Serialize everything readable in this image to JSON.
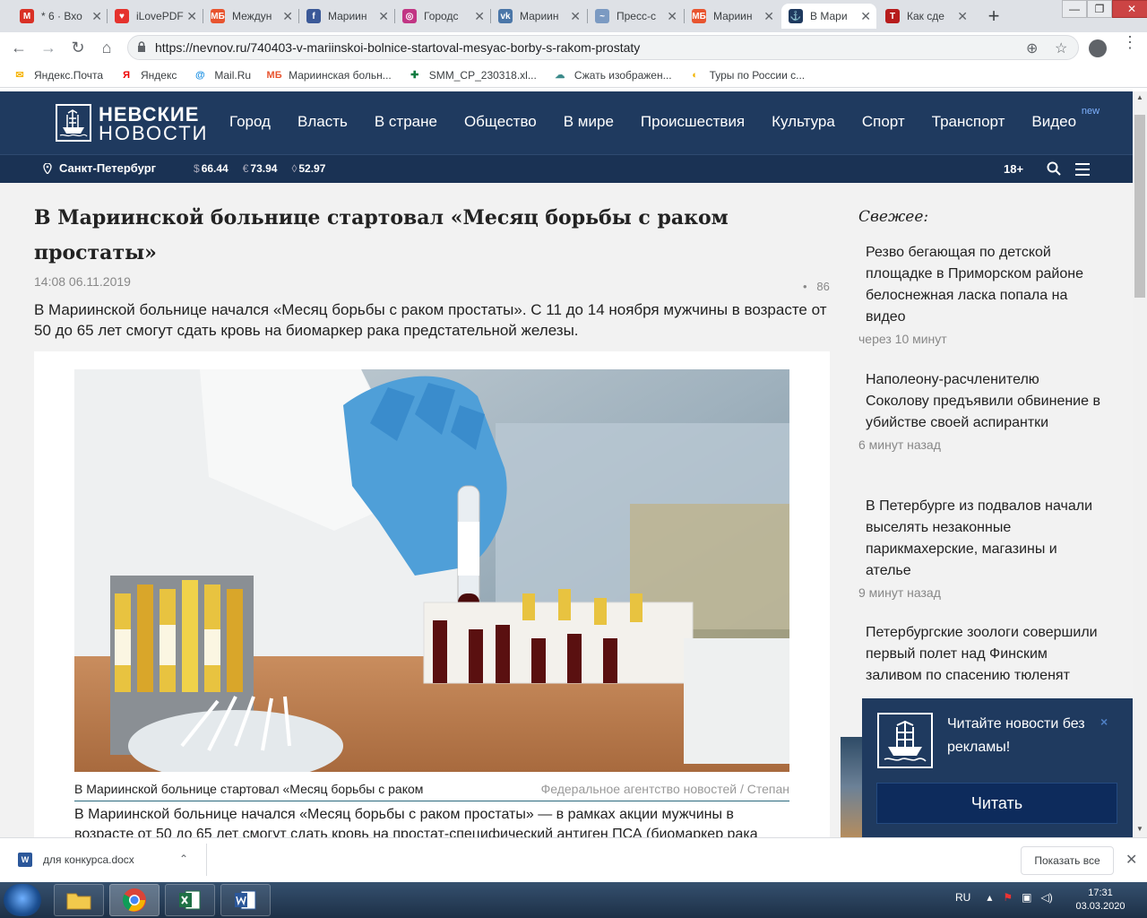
{
  "browser": {
    "tabs": [
      {
        "title": "* 6 · Вхо",
        "fav": "gmail-icon",
        "color": "#d93025",
        "glyph": "M"
      },
      {
        "title": "iLovePDF",
        "fav": "heart-icon",
        "color": "#e5322d",
        "glyph": "♥"
      },
      {
        "title": "Междун",
        "fav": "mb-icon",
        "color": "#e8542f",
        "glyph": "МБ"
      },
      {
        "title": "Мариин",
        "fav": "facebook-icon",
        "color": "#3b5998",
        "glyph": "f"
      },
      {
        "title": "Городс",
        "fav": "instagram-icon",
        "color": "#c13584",
        "glyph": "◎"
      },
      {
        "title": "Мариин",
        "fav": "vk-icon",
        "color": "#4a76a8",
        "glyph": "vk"
      },
      {
        "title": "Пресс-с",
        "fav": "press-icon",
        "color": "#7b9ac2",
        "glyph": "~"
      },
      {
        "title": "Мариин",
        "fav": "mb-icon",
        "color": "#e8542f",
        "glyph": "МБ"
      },
      {
        "title": "В Мари",
        "fav": "nevnov-icon",
        "color": "#1f3a5f",
        "glyph": "⚓"
      },
      {
        "title": "Как сде",
        "fav": "doc-icon",
        "color": "#b71c1c",
        "glyph": "T"
      }
    ],
    "url": "https://nevnov.ru/740403-v-mariinskoi-bolnice-startoval-mesyac-borby-s-rakom-prostaty",
    "bookmarks": [
      {
        "label": "Яндекс.Почта",
        "color": "#f6b400",
        "glyph": "✉"
      },
      {
        "label": "Яндекс",
        "color": "#e00",
        "glyph": "Я"
      },
      {
        "label": "Mail.Ru",
        "color": "#168de2",
        "glyph": "@"
      },
      {
        "label": "Мариинская больн...",
        "color": "#e8542f",
        "glyph": "МБ"
      },
      {
        "label": "SMM_CP_230318.xl...",
        "color": "#107c41",
        "glyph": "✚"
      },
      {
        "label": "Сжать изображен...",
        "color": "#3b8a8a",
        "glyph": "☁"
      },
      {
        "label": "Туры по России с...",
        "color": "#f2b400",
        "glyph": "◐"
      }
    ]
  },
  "site": {
    "logo_line1": "НЕВСКИЕ",
    "logo_line2": "НОВОСТИ",
    "nav": [
      "Город",
      "Власть",
      "В стране",
      "Общество",
      "В мире",
      "Происшествия",
      "Культура",
      "Спорт",
      "Транспорт",
      "Видео"
    ],
    "nav_badge": "new",
    "city": "Санкт-Петербург",
    "rates": [
      {
        "sym": "$",
        "value": "66.44"
      },
      {
        "sym": "€",
        "value": "73.94"
      },
      {
        "sym": "◊",
        "value": "52.97"
      }
    ],
    "age": "18+"
  },
  "article": {
    "title": "В Мариинской больнице стартовал «Месяц борьбы с раком простаты»",
    "date": "14:08 06.11.2019",
    "views_prefix": "•",
    "views": "86",
    "lead": "В Мариинской больнице начался «Месяц борьбы с раком простаты». С 11 до 14 ноября мужчины в возрасте от 50 до 65 лет смогут сдать кровь на биомаркер рака предстательной железы.",
    "caption": "В Мариинской больнице стартовал «Месяц борьбы с раком",
    "credit": "Федеральное агентство новостей / Степан",
    "body": "В Мариинской больнице начался «Месяц борьбы с раком простаты» — в рамках акции мужчины в возрасте от 50 до 65 лет смогут сдать кровь на простат-специфический антиген ПСА (биомаркер рака"
  },
  "sidebar": {
    "heading": "Свежее:",
    "items": [
      {
        "text": "Резво бегающая по детской площадке в Приморском районе белоснежная ласка попала на видео",
        "meta": "через 10 минут"
      },
      {
        "text": "Наполеону-расчленителю Соколову предъявили обвинение в убийстве своей аспирантки",
        "meta": "6 минут назад"
      },
      {
        "text": "В Петербурге из подвалов начали выселять незаконные парикмахерские, магазины и ателье",
        "meta": "9 минут назад"
      },
      {
        "text": "Петербургские зоологи совершили первый полет над Финским заливом по спасению тюленят",
        "meta": ""
      }
    ]
  },
  "popup": {
    "text": "Читайте новости без рекламы!",
    "close": "×",
    "button": "Читать"
  },
  "downloads": {
    "file": "для конкурса.docx",
    "show_all": "Показать все"
  },
  "taskbar": {
    "lang": "RU",
    "time": "17:31",
    "date": "03.03.2020"
  }
}
